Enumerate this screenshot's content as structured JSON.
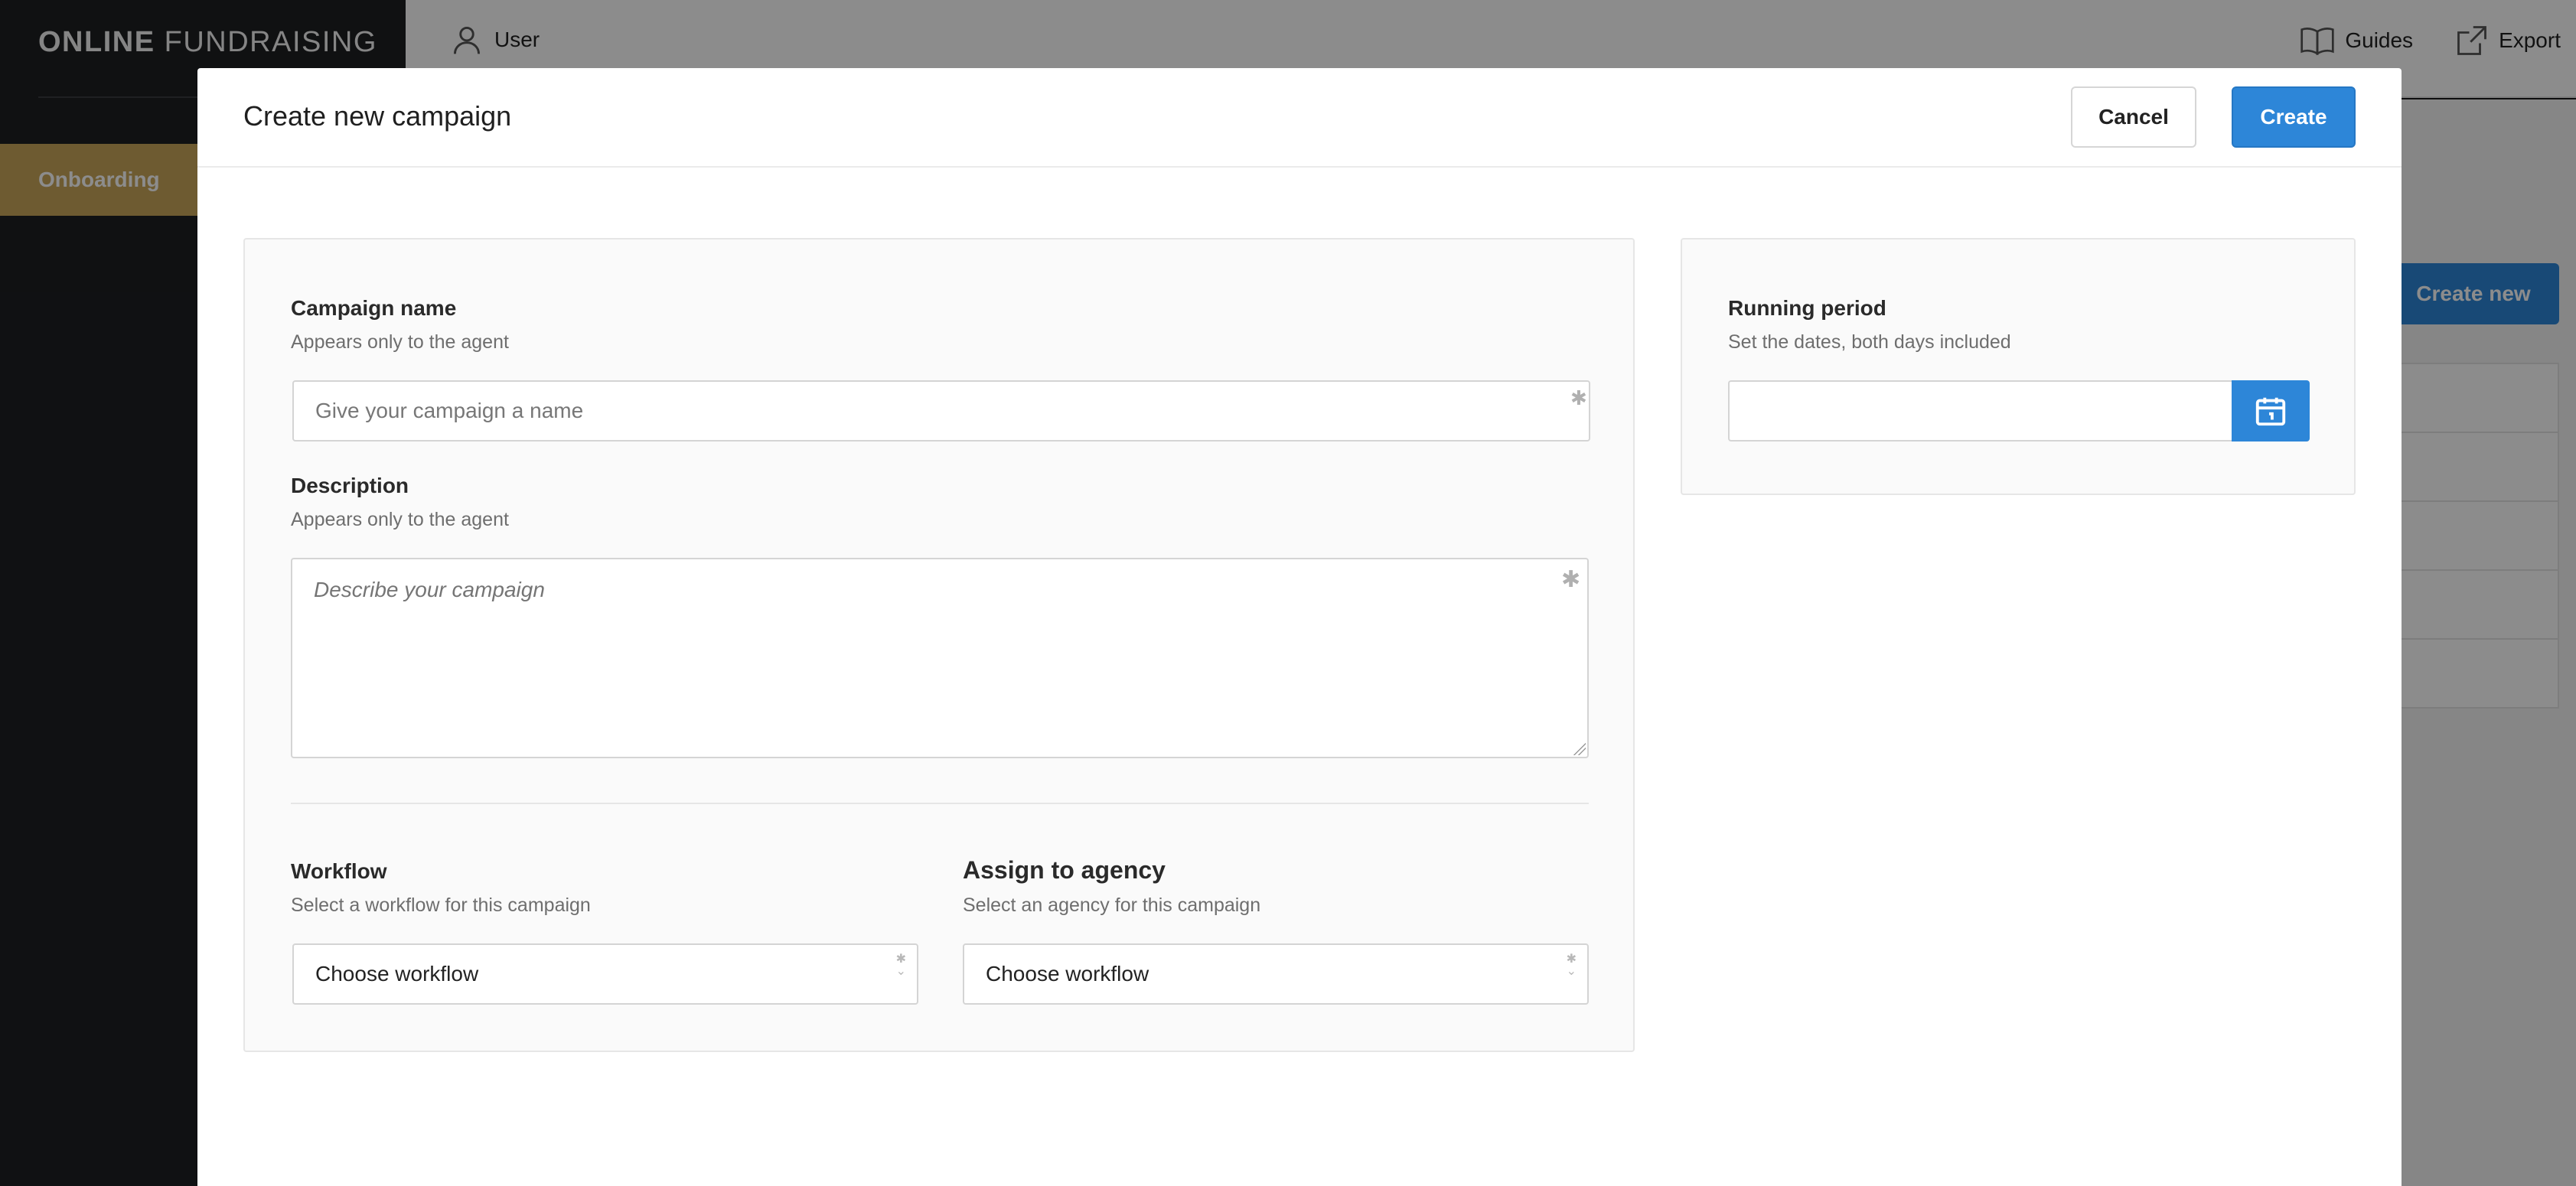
{
  "app": {
    "brand_bold": "ONLINE",
    "brand_light": "FUNDRAISING"
  },
  "sidebar": {
    "items": [
      {
        "label": "Onboarding",
        "active": true
      }
    ]
  },
  "topbar": {
    "user_label": "User",
    "guides_label": "Guides",
    "export_label": "Export"
  },
  "background": {
    "create_new_label": "Create new"
  },
  "modal": {
    "title": "Create new campaign",
    "cancel_label": "Cancel",
    "create_label": "Create",
    "campaign_name": {
      "label": "Campaign name",
      "hint": "Appears only to the agent",
      "placeholder": "Give your campaign a name",
      "value": ""
    },
    "description": {
      "label": "Description",
      "hint": "Appears only to the agent",
      "placeholder": "Describe your campaign",
      "value": ""
    },
    "workflow": {
      "label": "Workflow",
      "hint": "Select a workflow for this campaign",
      "selected": "Choose workflow"
    },
    "agency": {
      "label": "Assign to agency",
      "hint": "Select an agency for this campaign",
      "selected": "Choose workflow"
    },
    "running_period": {
      "label": "Running period",
      "hint": "Set the dates, both days included",
      "value": ""
    }
  },
  "colors": {
    "primary": "#2d86d8",
    "sidebar_active": "#c9a75a",
    "sidebar_bg": "#1e1f22"
  },
  "icons": {
    "user": "user-icon",
    "guides": "book-icon",
    "export": "export-icon",
    "calendar": "calendar-icon",
    "required": "asterisk-icon"
  }
}
